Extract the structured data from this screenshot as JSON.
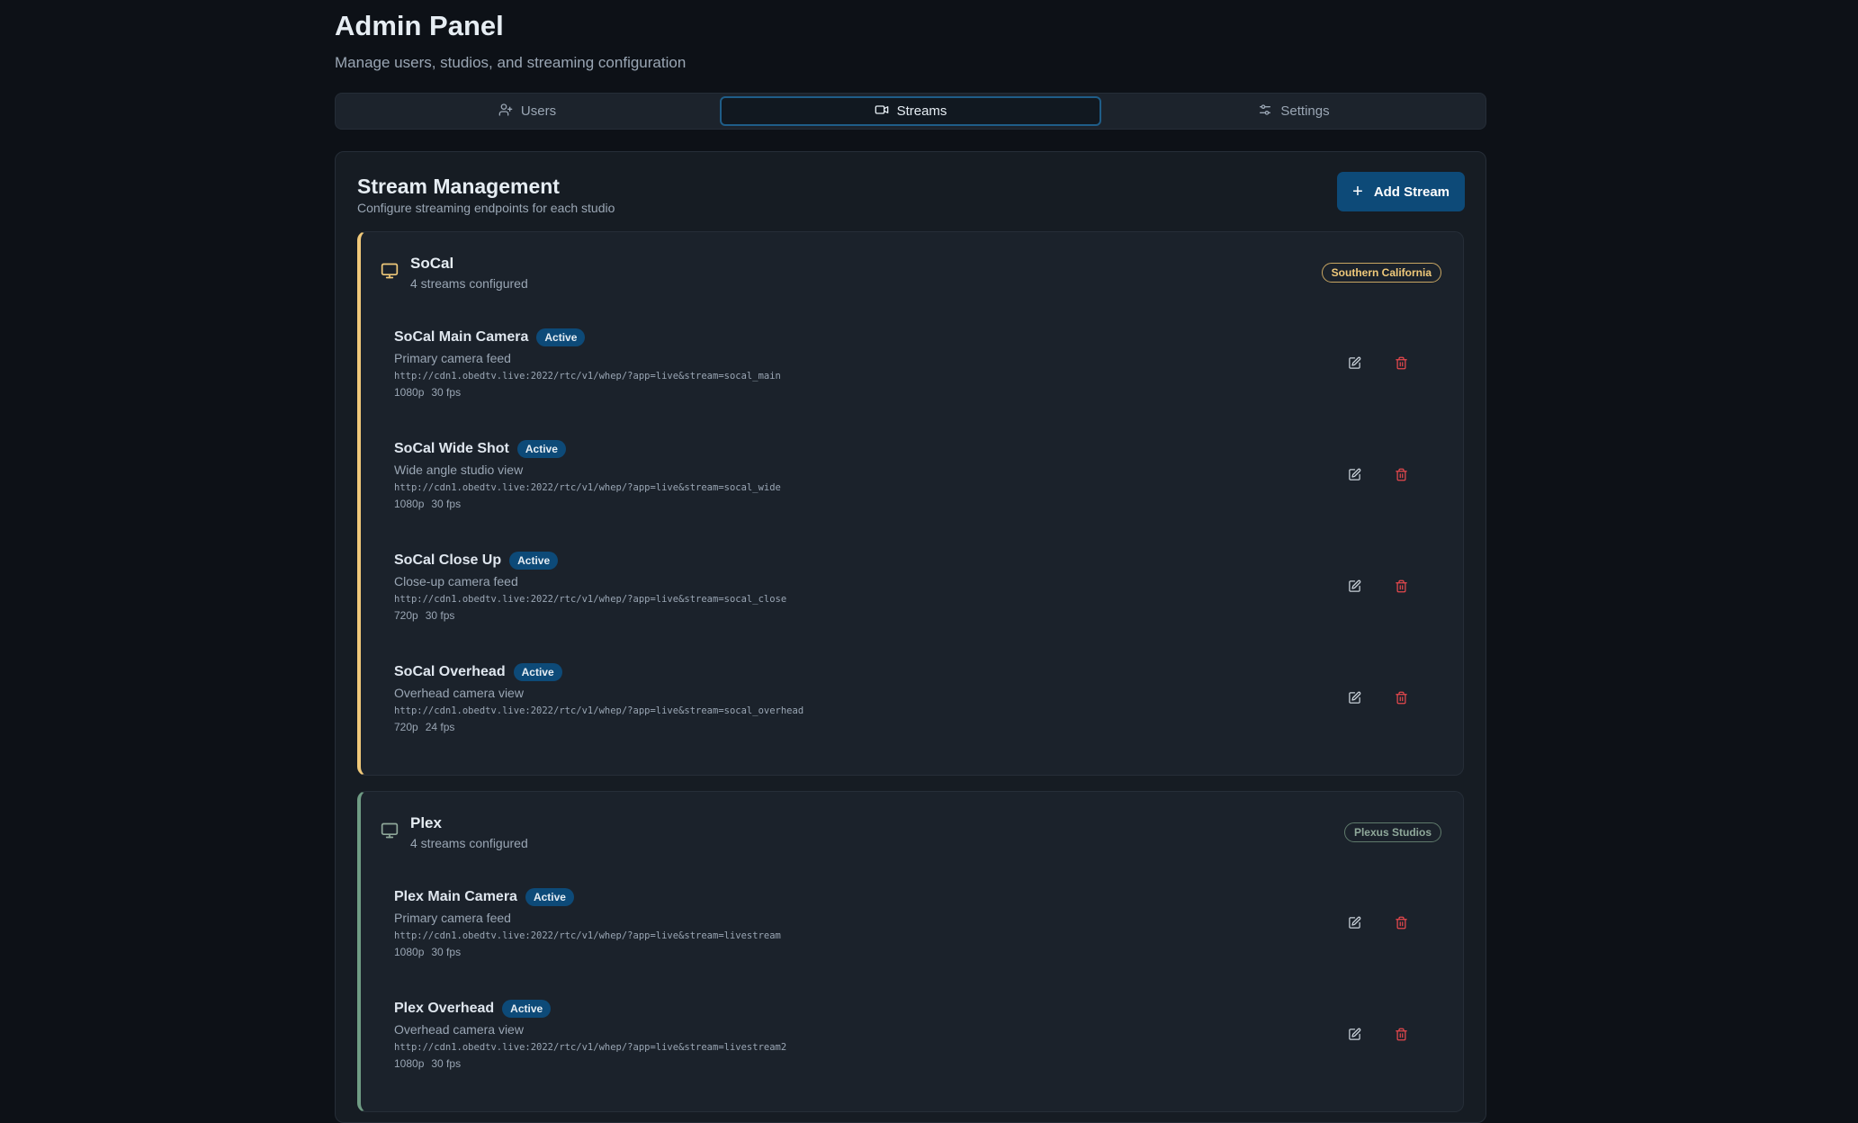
{
  "header": {
    "title": "Admin Panel",
    "subtitle": "Manage users, studios, and streaming configuration"
  },
  "tabs": [
    {
      "label": "Users",
      "icon": "user-plus-icon",
      "active": false
    },
    {
      "label": "Streams",
      "icon": "video-icon",
      "active": true
    },
    {
      "label": "Settings",
      "icon": "sliders-icon",
      "active": false
    }
  ],
  "card": {
    "title": "Stream Management",
    "description": "Configure streaming endpoints for each studio",
    "add_button_label": "Add Stream"
  },
  "studios": [
    {
      "name": "SoCal",
      "count": "4 streams configured",
      "badge": "Southern California",
      "accent": "#f0c97a",
      "streams": [
        {
          "name": "SoCal Main Camera",
          "status": "Active",
          "description": "Primary camera feed",
          "url": "http://cdn1.obedtv.live:2022/rtc/v1/whep/?app=live&stream=socal_main",
          "resolution": "1080p",
          "fps": "30 fps"
        },
        {
          "name": "SoCal Wide Shot",
          "status": "Active",
          "description": "Wide angle studio view",
          "url": "http://cdn1.obedtv.live:2022/rtc/v1/whep/?app=live&stream=socal_wide",
          "resolution": "1080p",
          "fps": "30 fps"
        },
        {
          "name": "SoCal Close Up",
          "status": "Active",
          "description": "Close-up camera feed",
          "url": "http://cdn1.obedtv.live:2022/rtc/v1/whep/?app=live&stream=socal_close",
          "resolution": "720p",
          "fps": "30 fps"
        },
        {
          "name": "SoCal Overhead",
          "status": "Active",
          "description": "Overhead camera view",
          "url": "http://cdn1.obedtv.live:2022/rtc/v1/whep/?app=live&stream=socal_overhead",
          "resolution": "720p",
          "fps": "24 fps"
        }
      ]
    },
    {
      "name": "Plex",
      "count": "4 streams configured",
      "badge": "Plexus Studios",
      "accent": "#6f9c84",
      "streams": [
        {
          "name": "Plex Main Camera",
          "status": "Active",
          "description": "Primary camera feed",
          "url": "http://cdn1.obedtv.live:2022/rtc/v1/whep/?app=live&stream=livestream",
          "resolution": "1080p",
          "fps": "30 fps"
        },
        {
          "name": "Plex Overhead",
          "status": "Active",
          "description": "Overhead camera view",
          "url": "http://cdn1.obedtv.live:2022/rtc/v1/whep/?app=live&stream=livestream2",
          "resolution": "1080p",
          "fps": "30 fps"
        }
      ]
    }
  ],
  "colors": {
    "background": "#0d1117",
    "accent": "#0d4a78",
    "delete": "#e5484d"
  }
}
